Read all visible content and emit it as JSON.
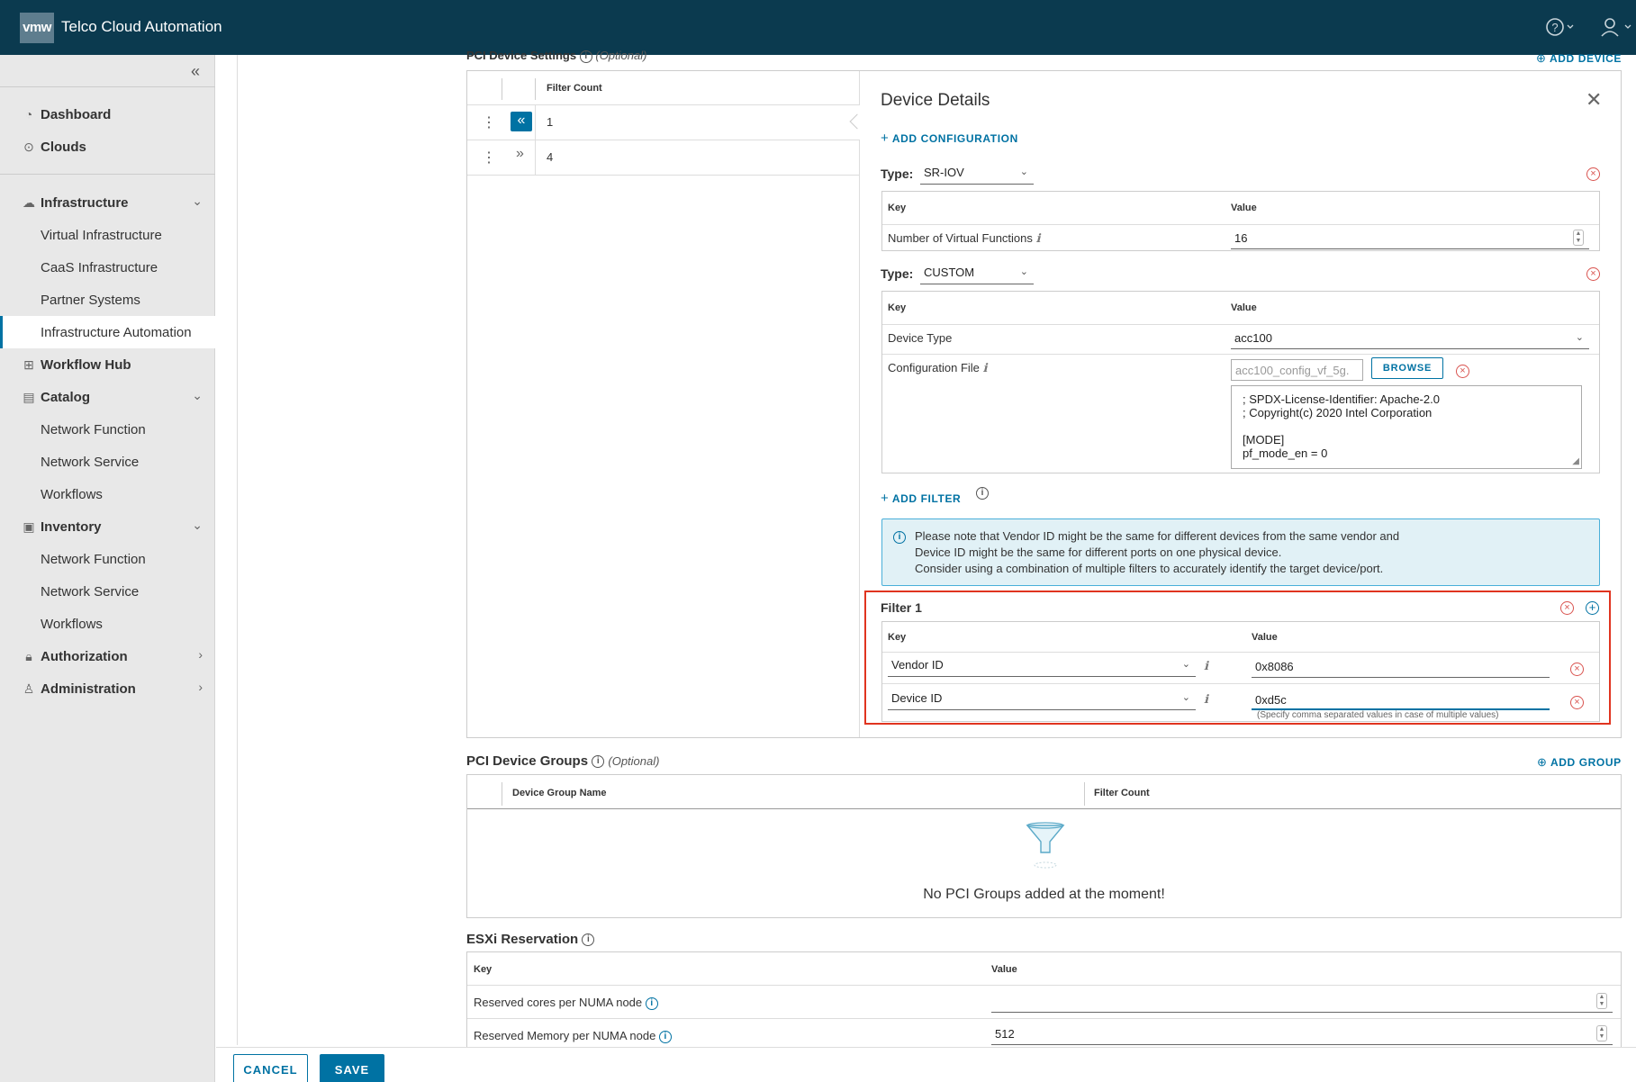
{
  "header": {
    "logo": "vmw",
    "title": "Telco Cloud Automation",
    "help_icon": "help-circle-icon",
    "user_icon": "user-icon"
  },
  "sidebar": {
    "collapse_icon": "double-chevron-left-icon",
    "items": [
      {
        "label": "Dashboard",
        "icon": "dashboard-icon"
      },
      {
        "label": "Clouds",
        "icon": "map-pin-icon"
      },
      {
        "label": "Infrastructure",
        "icon": "cloud-icon"
      },
      {
        "label": "Virtual Infrastructure"
      },
      {
        "label": "CaaS Infrastructure"
      },
      {
        "label": "Partner Systems"
      },
      {
        "label": "Infrastructure Automation"
      },
      {
        "label": "Workflow Hub",
        "icon": "workflow-icon"
      },
      {
        "label": "Catalog",
        "icon": "catalog-icon"
      },
      {
        "label": "Network Function"
      },
      {
        "label": "Network Service"
      },
      {
        "label": "Workflows"
      },
      {
        "label": "Inventory",
        "icon": "inventory-icon"
      },
      {
        "label": "Network Function"
      },
      {
        "label": "Network Service"
      },
      {
        "label": "Workflows"
      },
      {
        "label": "Authorization",
        "icon": "lock-icon"
      },
      {
        "label": "Administration",
        "icon": "user-icon"
      }
    ]
  },
  "pci_settings": {
    "title": "PCI Device Settings",
    "optional": "(Optional)",
    "add_device": "ADD DEVICE",
    "col_filter_count": "Filter Count",
    "rows": [
      {
        "filter_count": "1"
      },
      {
        "filter_count": "4"
      }
    ]
  },
  "device_details": {
    "title": "Device Details",
    "add_configuration": "ADD CONFIGURATION",
    "type_label": "Type:",
    "sriov": {
      "type": "SR-IOV",
      "col_key": "Key",
      "col_value": "Value",
      "row_key": "Number of Virtual Functions",
      "row_value": "16"
    },
    "custom": {
      "type": "CUSTOM",
      "col_key": "Key",
      "col_value": "Value",
      "device_type_key": "Device Type",
      "device_type_value": "acc100",
      "config_file_key": "Configuration File",
      "config_file_value": "acc100_config_vf_5g.",
      "browse": "BROWSE",
      "config_lines": [
        "; SPDX-License-Identifier: Apache-2.0",
        "; Copyright(c) 2020 Intel Corporation",
        "",
        "[MODE]",
        "pf_mode_en = 0"
      ]
    },
    "add_filter": "ADD FILTER",
    "note_lines": [
      "Please note that Vendor ID might be the same for different devices from the same vendor and",
      "Device ID might be the same for different ports on one physical device.",
      "Consider using a combination of multiple filters to accurately identify the target device/port."
    ],
    "filter": {
      "title": "Filter 1",
      "col_key": "Key",
      "col_value": "Value",
      "rows": [
        {
          "key": "Vendor ID",
          "value": "0x8086"
        },
        {
          "key": "Device ID",
          "value": "0xd5c"
        }
      ],
      "hint": "(Specify comma separated values in case of multiple values)",
      "highlight_color": "#e0341f"
    }
  },
  "pci_groups": {
    "title": "PCI Device Groups",
    "optional": "(Optional)",
    "add_group": "ADD GROUP",
    "col_name": "Device Group Name",
    "col_filter_count": "Filter Count",
    "empty_icon": "funnel-icon",
    "empty_text": "No PCI Groups added at the moment!"
  },
  "esxi": {
    "title": "ESXi Reservation",
    "col_key": "Key",
    "col_value": "Value",
    "rows": [
      {
        "key": "Reserved cores per NUMA node",
        "value": ""
      },
      {
        "key": "Reserved Memory per NUMA node",
        "value": "512"
      }
    ]
  },
  "footer": {
    "cancel": "CANCEL",
    "save": "SAVE"
  },
  "colors": {
    "header_bg": "#0b3a4f",
    "accent": "#0072a3",
    "danger": "#d9534f"
  }
}
